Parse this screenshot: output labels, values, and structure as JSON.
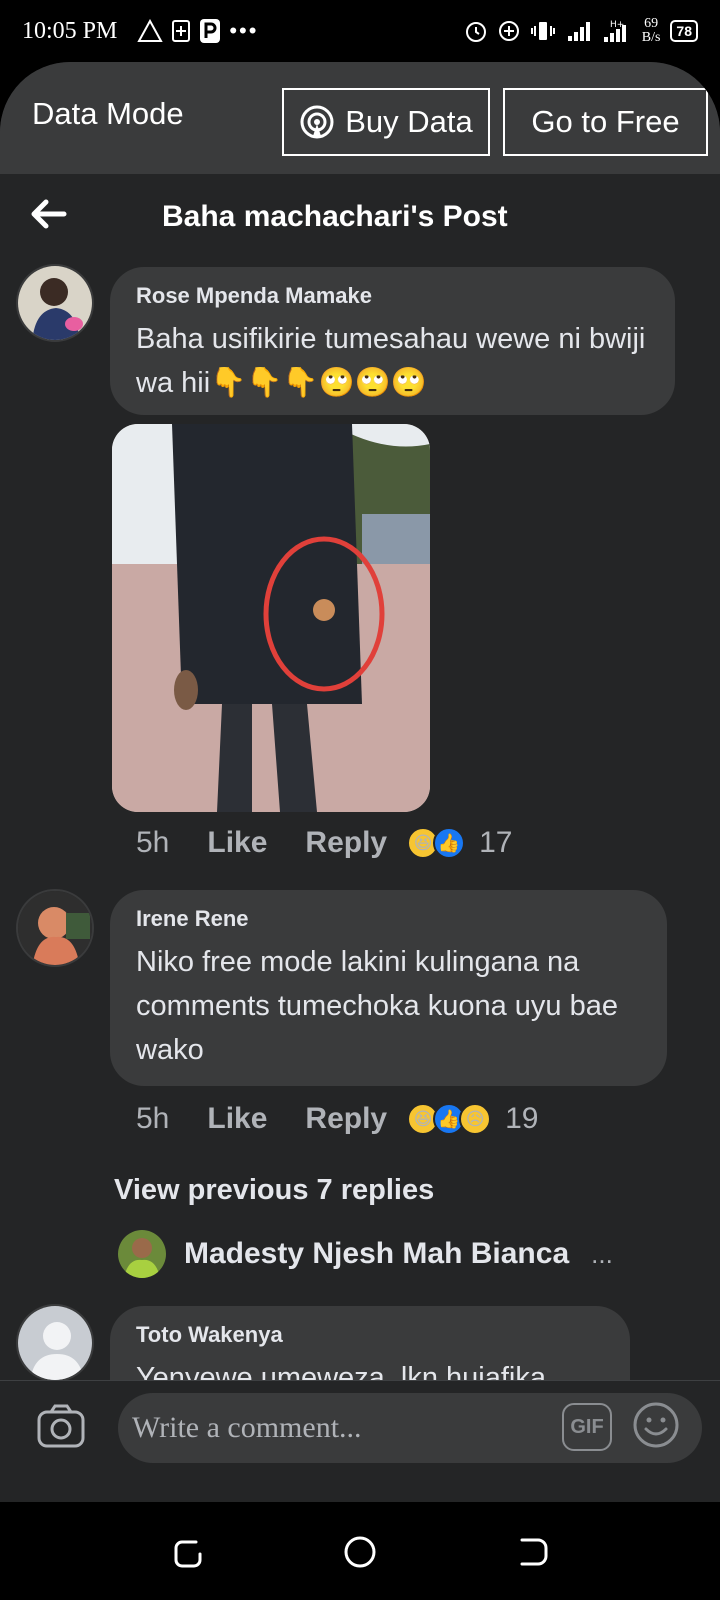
{
  "status_bar": {
    "time": "10:05 PM",
    "speed_value": "69",
    "speed_unit": "B/s",
    "battery": "78"
  },
  "data_banner": {
    "label": "Data Mode",
    "buy_data": "Buy Data",
    "go_free": "Go to Free"
  },
  "header": {
    "title": "Baha machachari's Post"
  },
  "comments": [
    {
      "author": "Rose Mpenda Mamake",
      "text": "Baha usifikirie tumesahau wewe ni bwiji wa hii👇👇👇🙄🙄🙄",
      "time": "5h",
      "like": "Like",
      "reply": "Reply",
      "reaction_count": "17"
    },
    {
      "author": "Irene Rene",
      "text": "Niko free mode lakini kulingana na comments tumechoka kuona uyu bae wako",
      "time": "5h",
      "like": "Like",
      "reply": "Reply",
      "reaction_count": "19"
    },
    {
      "author": "Toto Wakenya",
      "text": "Yenyewe umeweza, lkn hujafika"
    }
  ],
  "replies": {
    "view_previous": "View previous 7 replies",
    "latest_reply_author": "Madesty Njesh Mah Bianca",
    "more": "..."
  },
  "composer": {
    "placeholder": "Write a comment...",
    "gif": "GIF"
  },
  "colors": {
    "background": "#242526",
    "bubble": "#3a3b3c",
    "like_blue": "#1877f2",
    "text": "#e4e6eb",
    "secondary_text": "#b0b3b8"
  }
}
